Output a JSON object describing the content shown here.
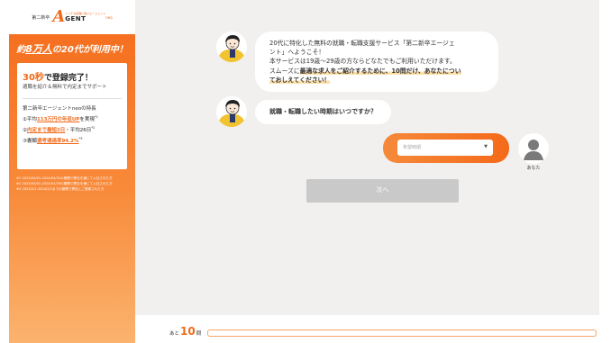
{
  "logo": {
    "prefix": "第二新卒",
    "letter": "A",
    "tagline": "ニッチな転職に強いエージェント",
    "word": "GENT",
    "suffix": "neo"
  },
  "sidebar": {
    "headline_pre": "約",
    "headline_num": "8万人",
    "headline_post": "の20代が利用中！",
    "card": {
      "title_num": "30秒",
      "title_rest": "で登録完了！",
      "sub": "適職を紹介＆無料で内定までサポート",
      "features_title": "第二新卒エージェントneoの特長",
      "features": [
        {
          "pre": "①平均",
          "hl": "113万円の年収UP",
          "post": "を実現",
          "sup": "*1"
        },
        {
          "pre": "②",
          "hl": "内定まで最短2日",
          "post": "・平均26日",
          "sup": "*2"
        },
        {
          "pre": "③書類",
          "hl": "選考通過率94.2%",
          "post": "",
          "sup": "*3"
        }
      ]
    },
    "notes": [
      "※1 2023/04/01-2024/03/31の期間で弊社を通じて入社された方",
      "※2 2023/03/01-2024/02/29の期間で弊社を通じて入社された方",
      "※3 2023/2/1-2024/2/1までの期間で弊社にご登録された方"
    ]
  },
  "chat": {
    "msg1": [
      "20代に特化した無料の就職・転職支援サービス「第二新卒エージェ",
      "ント」へようこそ！",
      "本サービスは19歳〜29歳の方ならどなたでもご利用いただけます。",
      "スムーズに"
    ],
    "msg1_mark": "最適な求人をご紹介するために、10問だけ、あなたについ",
    "msg1_mark2": "ておしえてください！",
    "msg2": "就職・転職したい時期はいつですか？",
    "select_placeholder": "希望時期",
    "user_label": "あなた",
    "next_label": "次へ"
  },
  "progress": {
    "remain_pre": "あと",
    "remain_num": "10",
    "remain_post": "問",
    "fraction": 0
  },
  "colors": {
    "accent": "#f46a1a",
    "bg": "#f1f0ee",
    "button_disabled": "#c9c9c9"
  }
}
